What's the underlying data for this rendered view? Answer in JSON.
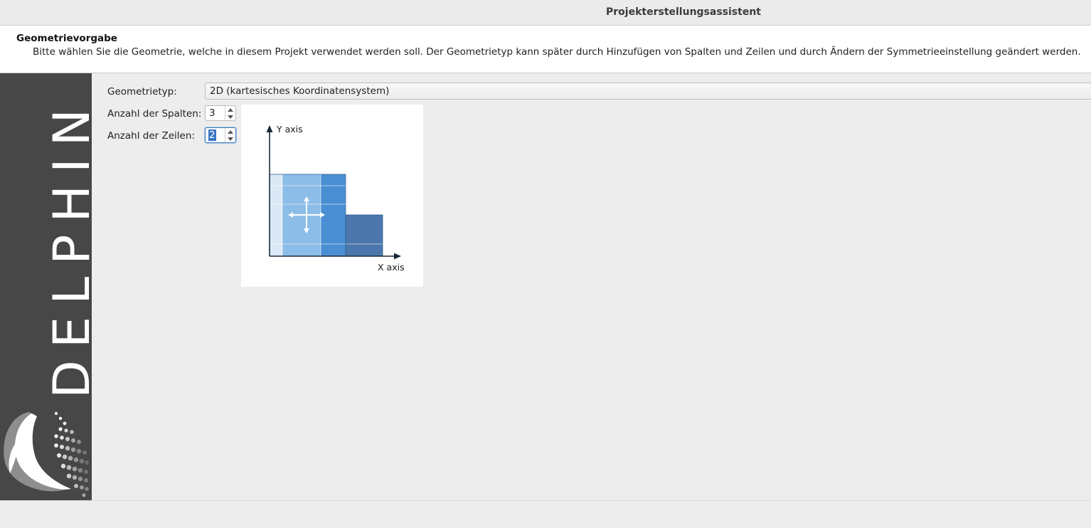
{
  "window": {
    "title": "Projekterstellungsassistent"
  },
  "header": {
    "title": "Geometrievorgabe",
    "description": "Bitte wählen Sie die Geometrie, welche in diesem Projekt verwendet werden soll. Der Geometrietyp kann später durch Hinzufügen von Spalten und Zeilen und durch Ändern der Symmetrieeinstellung geändert werden."
  },
  "sidebar": {
    "logo_text": "DELPHIN"
  },
  "form": {
    "geometry_type_label": "Geometrietyp:",
    "geometry_type_value": "2D (kartesisches Koordinatensystem)",
    "columns_label": "Anzahl der Spalten:",
    "columns_value": "3",
    "rows_label": "Anzahl der Zeilen:",
    "rows_value": "2"
  },
  "diagram": {
    "y_axis_label": "Y axis",
    "x_axis_label": "X axis"
  },
  "colors": {
    "sidebar": "#474747",
    "header_bg": "#ffffff",
    "window_bg": "#ededed",
    "focus": "#3874c4",
    "cell_light": "#dbe9f6",
    "cell_mid": "#8cbde8",
    "cell_blue": "#4a8fd3",
    "cell_dark": "#4b77ac"
  }
}
